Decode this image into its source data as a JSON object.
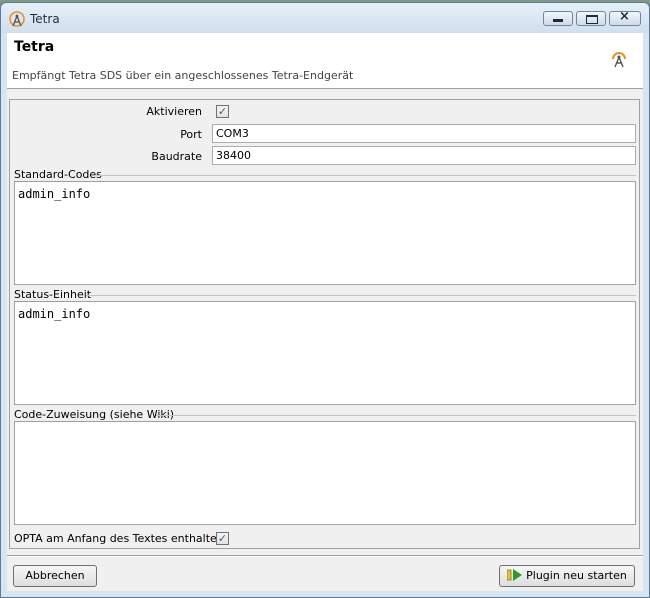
{
  "window": {
    "title": "Tetra"
  },
  "header": {
    "title": "Tetra",
    "description": "Empfängt Tetra SDS über ein angeschlossenes Tetra-Endgerät"
  },
  "form": {
    "activate_label": "Aktivieren",
    "activate_checked": true,
    "port_label": "Port",
    "port_value": "COM3",
    "baudrate_label": "Baudrate",
    "baudrate_value": "38400",
    "standard_codes_label": "Standard-Codes",
    "standard_codes_value": "admin_info",
    "status_unit_label": "Status-Einheit",
    "status_unit_value": "admin_info",
    "code_assignment_label": "Code-Zuweisung (siehe Wiki)",
    "code_assignment_value": "",
    "opta_label": "OPTA am Anfang des Textes enthalten",
    "opta_checked": true
  },
  "buttons": {
    "cancel": "Abbrechen",
    "restart": "Plugin neu starten"
  },
  "icons": {
    "app": "tetra-antenna-icon",
    "restart": "play-icon",
    "check": "checkmark"
  },
  "colors": {
    "accent_orange": "#e8921e",
    "play_green": "#2e9a2e"
  }
}
